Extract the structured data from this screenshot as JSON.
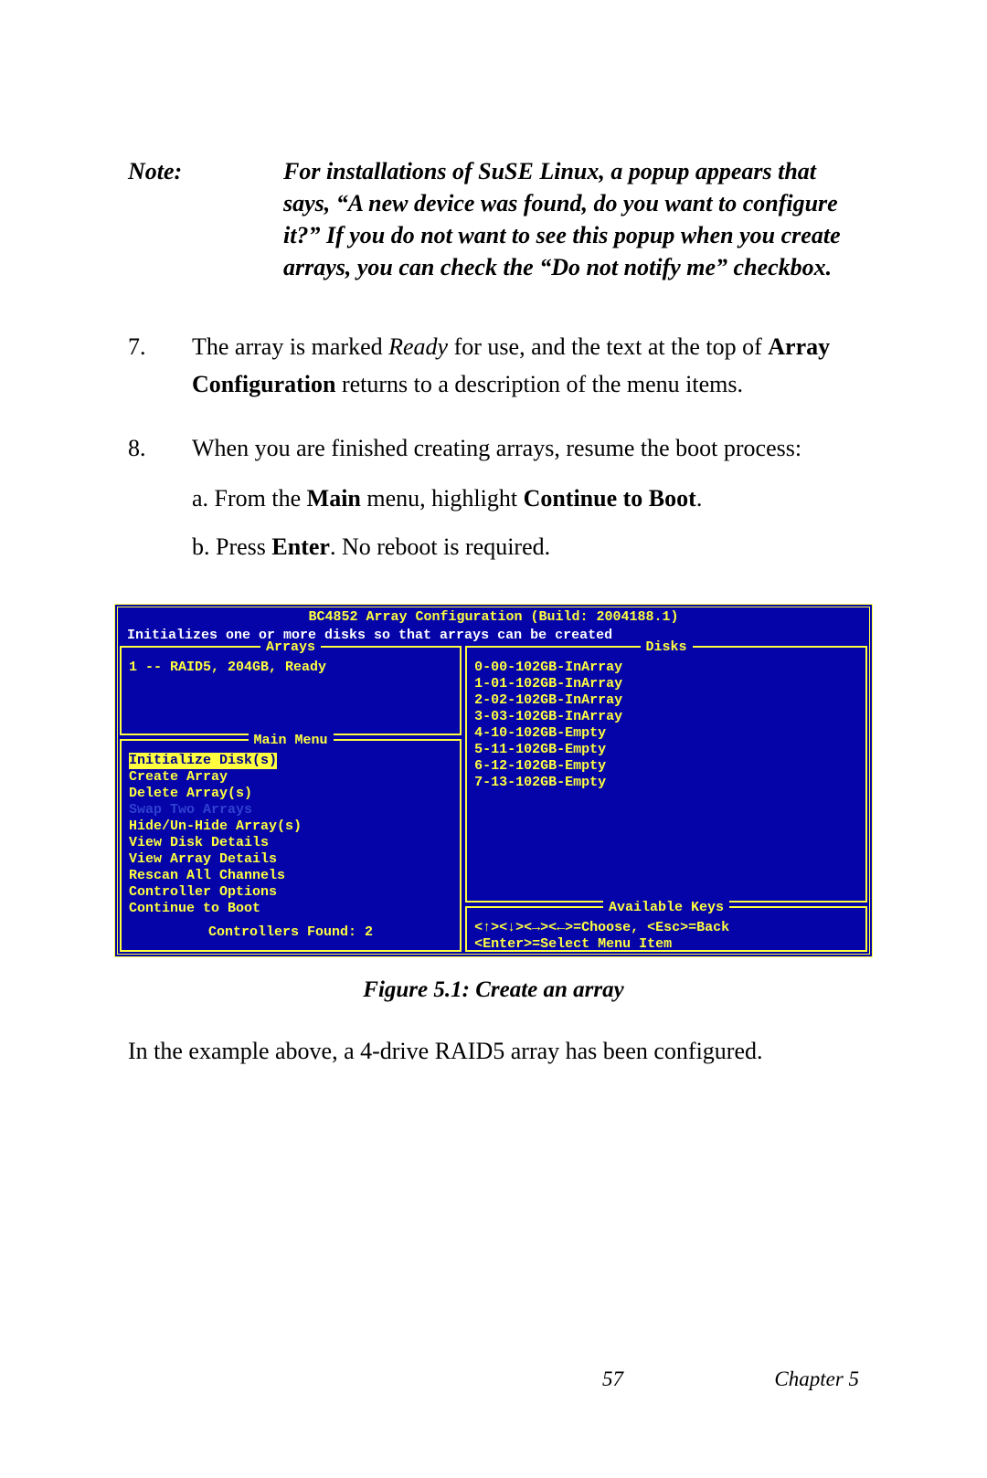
{
  "note": {
    "label": "Note:",
    "text": "For installations of SuSE Linux, a popup appears that says, “A new device was found, do you want to configure it?” If you do not want to see this popup when you create arrays, you can check the “Do not notify me” checkbox."
  },
  "step7": {
    "num": "7.",
    "t1": "The array is marked ",
    "ready": "Ready",
    "t2": " for use, and the text at the top of ",
    "ac": "Array Configuration",
    "t3": " returns to a description of the menu items."
  },
  "step8": {
    "num": "8.",
    "lead": "When you are finished creating arrays, resume the boot process:",
    "a1": "a. From the ",
    "a_main": "Main",
    "a2": " menu, highlight ",
    "a_ctb": "Continue to Boot",
    "a3": ".",
    "b1": "b. Press ",
    "b_enter": "Enter",
    "b2": ". No reboot is required."
  },
  "bios": {
    "title": "BC4852 Array Configuration (Build: 2004188.1)",
    "desc": "Initializes one or more disks so that arrays can be created",
    "arrays_title": "Arrays",
    "arrays_row": "1 -- RAID5, 204GB, Ready",
    "disks_title": "Disks",
    "disks": {
      "d0": "0-00-102GB-InArray",
      "d1": "1-01-102GB-InArray",
      "d2": "2-02-102GB-InArray",
      "d3": "3-03-102GB-InArray",
      "d4": "4-10-102GB-Empty",
      "d5": "5-11-102GB-Empty",
      "d6": "6-12-102GB-Empty",
      "d7": "7-13-102GB-Empty"
    },
    "mainmenu_title": "Main Menu",
    "menu": {
      "m0": "Initialize Disk(s)",
      "m1": "Create Array",
      "m2": "Delete Array(s)",
      "m3": "Swap Two Arrays",
      "m4": "Hide/Un-Hide Array(s)",
      "m5": "View Disk Details",
      "m6": "View Array Details",
      "m7": "Rescan All Channels",
      "m8": "Controller Options",
      "m9": "Continue to Boot"
    },
    "controllers_found": "Controllers Found: 2",
    "keys_title": "Available Keys",
    "keys_line1": "<↑><↓><→><←>=Choose, <Esc>=Back",
    "keys_line2": "<Enter>=Select Menu Item"
  },
  "figure_caption": "Figure 5.1:  Create an array",
  "example_line": "In the example above, a 4-drive RAID5 array has been configured.",
  "footer": {
    "page": "57",
    "chapter": "Chapter 5"
  }
}
